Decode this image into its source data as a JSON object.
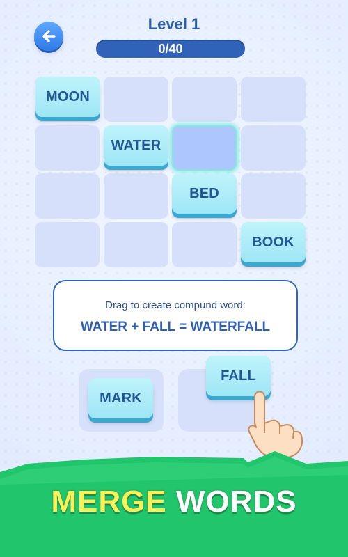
{
  "header": {
    "level_title": "Level 1",
    "progress_text": "0/40",
    "progress_value": 0,
    "progress_max": 40
  },
  "grid": {
    "tiles": [
      {
        "label": "MOON"
      },
      {
        "label": "WATER"
      },
      {
        "label": "BED"
      },
      {
        "label": "BOOK"
      }
    ]
  },
  "hint": {
    "instruction": "Drag to create compund word:",
    "example": "WATER + FALL = WATERFALL"
  },
  "tray": {
    "tiles": [
      {
        "label": "MARK"
      },
      {
        "label": "FALL"
      }
    ]
  },
  "banner": {
    "word1": "MERGE",
    "word2": "WORDS"
  },
  "colors": {
    "tile_face": "#9ee6f6",
    "tile_text": "#215796",
    "accent_blue": "#2f64bb",
    "banner_green": "#22c76a",
    "banner_yellow": "#f9f05a"
  },
  "icons": {
    "back": "arrow-left-icon",
    "hand": "pointing-hand-icon"
  }
}
